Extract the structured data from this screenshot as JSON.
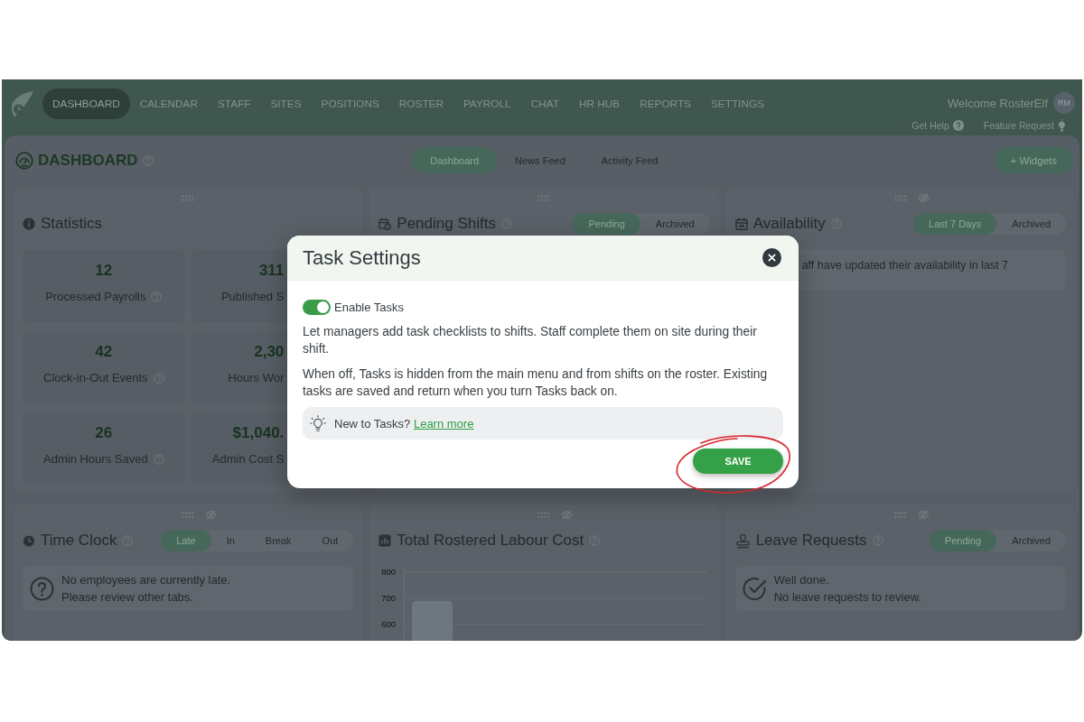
{
  "nav": {
    "items": [
      {
        "label": "DASHBOARD",
        "selected": true
      },
      {
        "label": "CALENDAR",
        "selected": false
      },
      {
        "label": "STAFF",
        "selected": false
      },
      {
        "label": "SITES",
        "selected": false
      },
      {
        "label": "POSITIONS",
        "selected": false
      },
      {
        "label": "ROSTER",
        "selected": false
      },
      {
        "label": "PAYROLL",
        "selected": false
      },
      {
        "label": "CHAT",
        "selected": false
      },
      {
        "label": "HR HUB",
        "selected": false
      },
      {
        "label": "REPORTS",
        "selected": false
      },
      {
        "label": "SETTINGS",
        "selected": false
      }
    ],
    "welcome": "Welcome RosterElf",
    "avatar": "RM",
    "links": [
      "Get Help",
      "Feature Request"
    ]
  },
  "page": {
    "title": "DASHBOARD",
    "tabs": [
      {
        "label": "Dashboard",
        "selected": true
      },
      {
        "label": "News Feed",
        "selected": false
      },
      {
        "label": "Activity Feed",
        "selected": false
      }
    ],
    "widgets_button": "+ Widgets"
  },
  "widgets": [
    {
      "kind": "stats",
      "title": "Statistics",
      "help": false,
      "hideable": false,
      "stats": [
        {
          "value": "12",
          "label": "Processed Payrolls",
          "help": true
        },
        {
          "value": "311",
          "label": "Published S",
          "help": false
        },
        {
          "value": "42",
          "label": "Clock-in-Out Events",
          "help": true
        },
        {
          "value": "2,30",
          "label": "Hours Wor",
          "help": false
        },
        {
          "value": "26",
          "label": "Admin Hours Saved",
          "help": true
        },
        {
          "value": "$1,040.",
          "label": "Admin Cost S",
          "help": false
        }
      ]
    },
    {
      "kind": "empty",
      "title": "Pending Shifts",
      "help": true,
      "hideable": false,
      "tabs": [
        {
          "label": "Pending",
          "selected": true
        },
        {
          "label": "Archived",
          "selected": false
        }
      ]
    },
    {
      "kind": "note",
      "title": "Availability",
      "help": true,
      "hideable": true,
      "tabs": [
        {
          "label": "Last 7 Days",
          "selected": true
        },
        {
          "label": "Archived",
          "selected": false
        }
      ],
      "note": "aff have updated their availability in last 7"
    },
    {
      "kind": "message",
      "title": "Time Clock",
      "help": true,
      "hideable": true,
      "tabs": [
        {
          "label": "Late",
          "selected": true
        },
        {
          "label": "In",
          "selected": false
        },
        {
          "label": "Break",
          "selected": false
        },
        {
          "label": "Out",
          "selected": false
        }
      ],
      "lines": [
        "No employees are currently late.",
        "Please review other tabs."
      ]
    },
    {
      "kind": "chart",
      "title": "Total Rostered Labour Cost",
      "help": true,
      "hideable": true,
      "chart_data": {
        "type": "bar",
        "categories": [
          null
        ],
        "values": [
          690
        ],
        "ylim": [
          531,
          824
        ],
        "yticks": [
          600,
          700,
          800
        ],
        "grid": true
      }
    },
    {
      "kind": "message",
      "title": "Leave Requests",
      "help": true,
      "hideable": true,
      "tabs": [
        {
          "label": "Pending",
          "selected": true
        },
        {
          "label": "Archived",
          "selected": false
        }
      ],
      "lines": [
        "Well done.",
        "No leave requests to review."
      ]
    }
  ],
  "modal": {
    "title": "Task Settings",
    "toggle": {
      "label": "Enable Tasks",
      "on": true
    },
    "paragraphs": [
      "Let managers add task checklists to shifts. Staff complete them on site during their shift.",
      "When off, Tasks is hidden from the main menu and from shifts on the roster. Existing tasks are saved and return when you turn Tasks back on."
    ],
    "tip": {
      "text": "New to Tasks?",
      "link": "Learn more"
    },
    "save_button": {
      "label": "SAVE",
      "circled": true
    }
  }
}
